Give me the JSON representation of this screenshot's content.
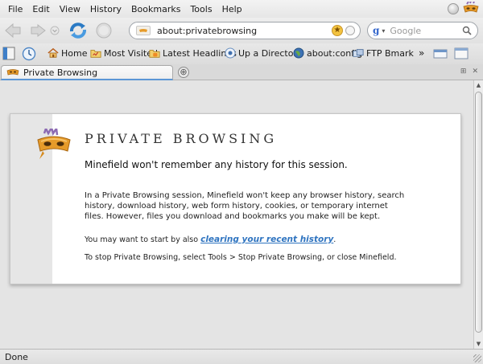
{
  "menubar": {
    "items": [
      {
        "label": "File"
      },
      {
        "label": "Edit"
      },
      {
        "label": "View"
      },
      {
        "label": "History"
      },
      {
        "label": "Bookmarks"
      },
      {
        "label": "Tools"
      },
      {
        "label": "Help"
      }
    ]
  },
  "navbar": {
    "url": "about:privatebrowsing",
    "search_engine": "g",
    "search_placeholder": "Google"
  },
  "bookmarks": {
    "items": [
      {
        "label": "Home",
        "icon": "house-icon"
      },
      {
        "label": "Most Visited",
        "icon": "folder-icon"
      },
      {
        "label": "Latest Headlines",
        "icon": "rss-icon"
      },
      {
        "label": "Up a Directory",
        "icon": "up-arrow-icon"
      },
      {
        "label": "about:config",
        "icon": "globe-icon"
      },
      {
        "label": "FTP Bmark",
        "icon": "ftp-icon"
      }
    ],
    "overflow": "»"
  },
  "tab": {
    "title": "Private Browsing",
    "newtab": "⊕"
  },
  "page": {
    "title": "PRIVATE BROWSING",
    "subtitle": "Minefield won't remember any history for this session.",
    "body": "In a Private Browsing session, Minefield won't keep any browser history, search history, download history, web form history, cookies, or temporary internet files. However, files you download and bookmarks you make will be kept.",
    "hint_prefix": "You may want to start by also ",
    "hint_link": "clearing your recent history",
    "hint_suffix": ".",
    "stop_text": "To stop Private Browsing, select Tools > Stop Private Browsing, or close Minefield."
  },
  "status": {
    "text": "Done"
  },
  "colors": {
    "accent": "#5b96d6",
    "link": "#2f74c0",
    "mask_orange": "#e69b2a",
    "mask_purple": "#8c6bb3"
  }
}
